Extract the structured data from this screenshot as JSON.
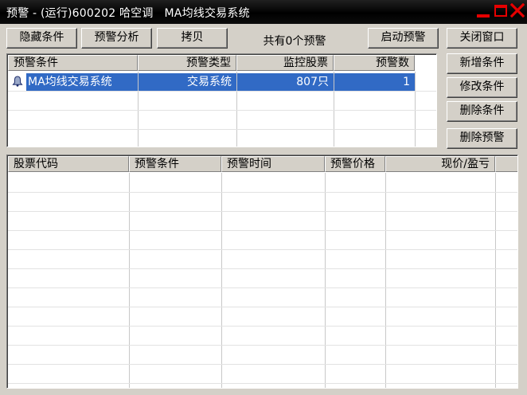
{
  "window": {
    "title": "预警 - (运行)600202 哈空调   MA均线交易系统"
  },
  "toolbar": {
    "hide_conditions": "隐藏条件",
    "alert_analysis": "预警分析",
    "copy": "拷贝",
    "count_label": "共有0个预警",
    "start_alert": "启动预警",
    "close_window": "关闭窗口"
  },
  "side_buttons": {
    "add_condition": "新增条件",
    "edit_condition": "修改条件",
    "delete_condition": "删除条件",
    "delete_alert": "删除预警"
  },
  "conditions_table": {
    "columns": [
      "预警条件",
      "预警类型",
      "监控股票",
      "预警数"
    ],
    "rows": [
      {
        "condition": "MA均线交易系统",
        "type": "交易系统",
        "stocks": "807只",
        "count": "1"
      }
    ]
  },
  "alerts_table": {
    "columns": [
      "股票代码",
      "预警条件",
      "预警时间",
      "预警价格",
      "现价/盈亏"
    ],
    "rows": []
  },
  "colors": {
    "selection": "#316ac5",
    "caption_buttons": "#e60000",
    "face": "#d4d0c8"
  },
  "icons": {
    "row_icon": "bell-icon",
    "minimize": "minimize-icon",
    "maximize": "maximize-icon",
    "close": "close-icon"
  }
}
